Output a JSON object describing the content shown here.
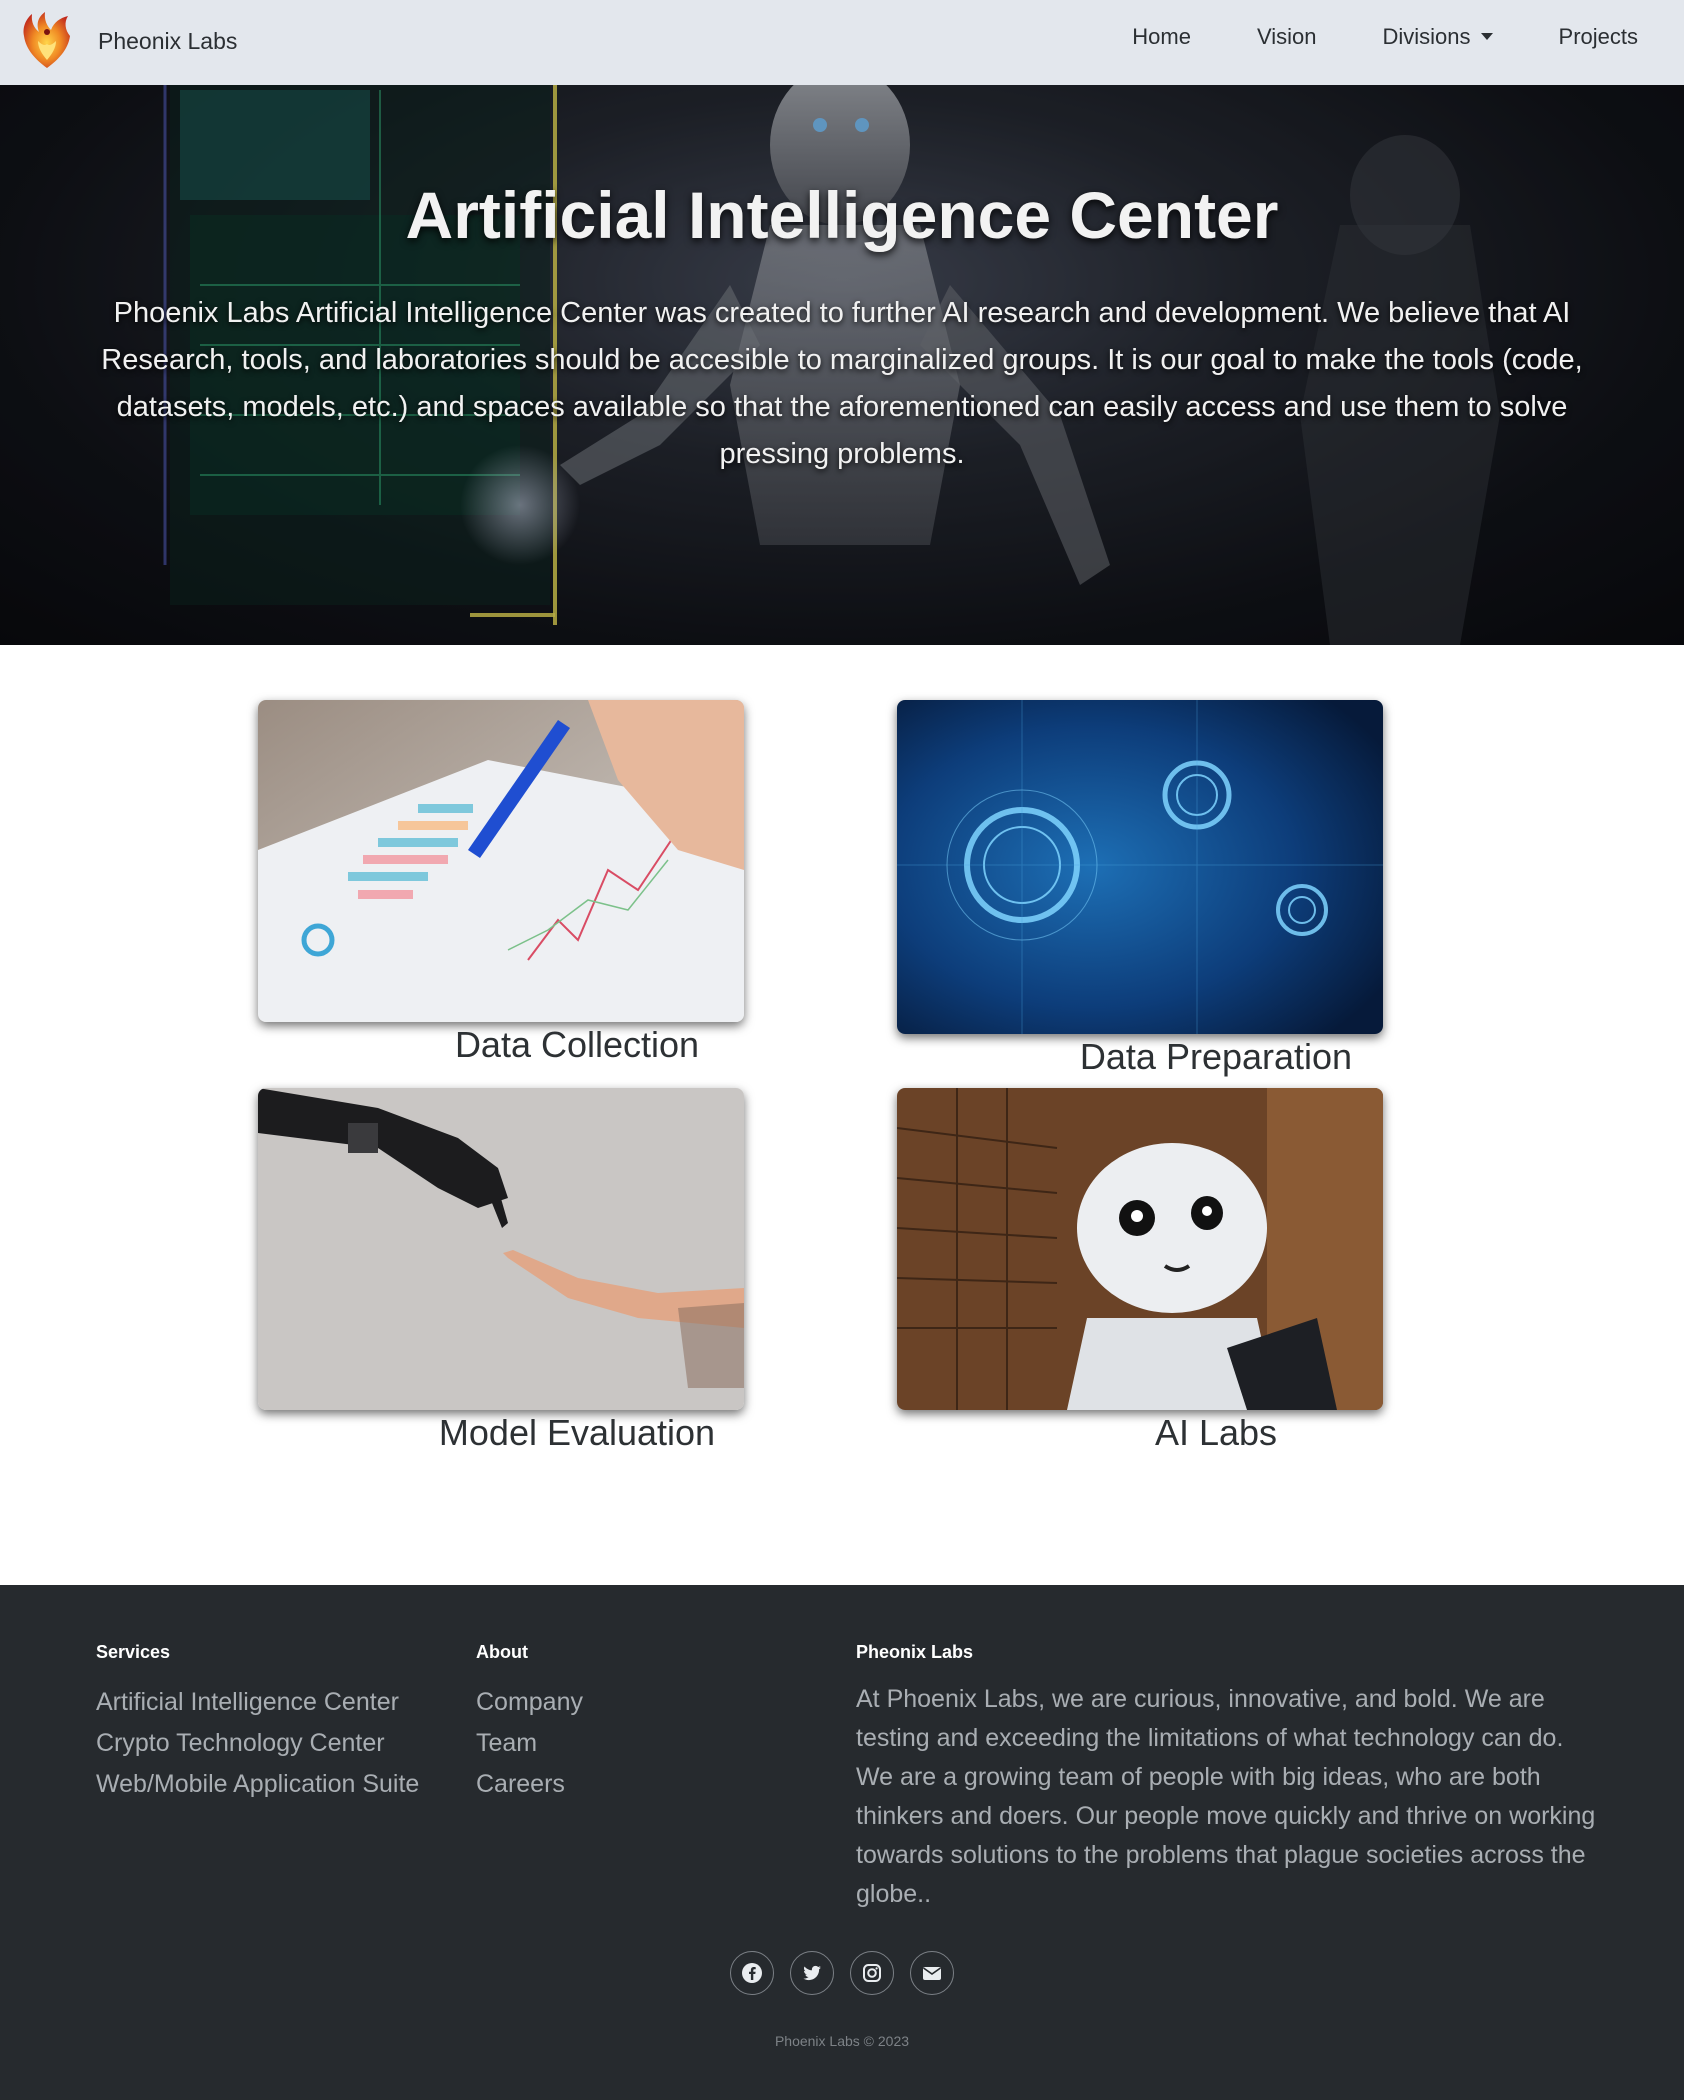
{
  "navbar": {
    "brand": "Pheonix Labs",
    "links": [
      "Home",
      "Vision",
      "Divisions",
      "Projects"
    ]
  },
  "hero": {
    "title": "Artificial Intelligence Center",
    "description": "Phoenix Labs Artificial Intelligence Center was created to further AI research and development. We believe that AI Research, tools, and laboratories should be accesible to marginalized groups. It is our goal to make the tools (code, datasets, models, etc.) and spaces available so that the aforementioned can easily access and use them to solve pressing problems."
  },
  "cards": [
    {
      "title": "Data Collection"
    },
    {
      "title": "Data Preparation"
    },
    {
      "title": "Model Evaluation"
    },
    {
      "title": "AI Labs"
    }
  ],
  "footer": {
    "services": {
      "heading": "Services",
      "items": [
        "Artificial Intelligence Center",
        "Crypto Technology Center",
        "Web/Mobile Application Suite"
      ]
    },
    "about": {
      "heading": "About",
      "items": [
        "Company",
        "Team",
        "Careers"
      ]
    },
    "company": {
      "heading": "Pheonix Labs",
      "text": "At Phoenix Labs, we are curious, innovative, and bold. We are testing and exceeding the limitations of what technology can do. We are a growing team of people with big ideas, who are both thinkers and doers. Our people move quickly and thrive on working towards solutions to the problems that plague societies across the globe.."
    },
    "socials": [
      "facebook-icon",
      "twitter-icon",
      "instagram-icon",
      "envelope-icon"
    ],
    "copyright": "Phoenix Labs © 2023"
  },
  "colors": {
    "navbar_bg": "#e2e6ec",
    "footer_bg": "#262a2e",
    "footer_text": "#a9aeb3"
  }
}
